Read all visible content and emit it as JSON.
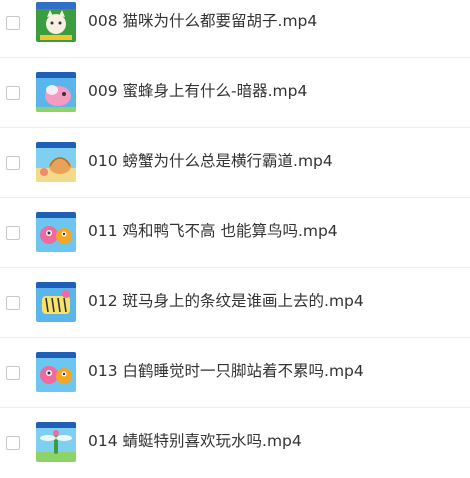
{
  "files": [
    {
      "name": "008 猫咪为什么都要留胡子.mp4",
      "thumbnail": "cartoon-cat-thumbnail"
    },
    {
      "name": "009 蜜蜂身上有什么-暗器.mp4",
      "thumbnail": "cartoon-bee-thumbnail"
    },
    {
      "name": "010 螃蟹为什么总是横行霸道.mp4",
      "thumbnail": "cartoon-crab-thumbnail"
    },
    {
      "name": "011 鸡和鸭飞不高 也能算鸟吗.mp4",
      "thumbnail": "cartoon-birds-thumbnail"
    },
    {
      "name": "012 斑马身上的条纹是谁画上去的.mp4",
      "thumbnail": "cartoon-zebra-thumbnail"
    },
    {
      "name": "013 白鹤睡觉时一只脚站着不累吗.mp4",
      "thumbnail": "cartoon-crane-thumbnail"
    },
    {
      "name": "014 蜻蜓特别喜欢玩水吗.mp4",
      "thumbnail": "cartoon-dragonfly-thumbnail"
    }
  ]
}
